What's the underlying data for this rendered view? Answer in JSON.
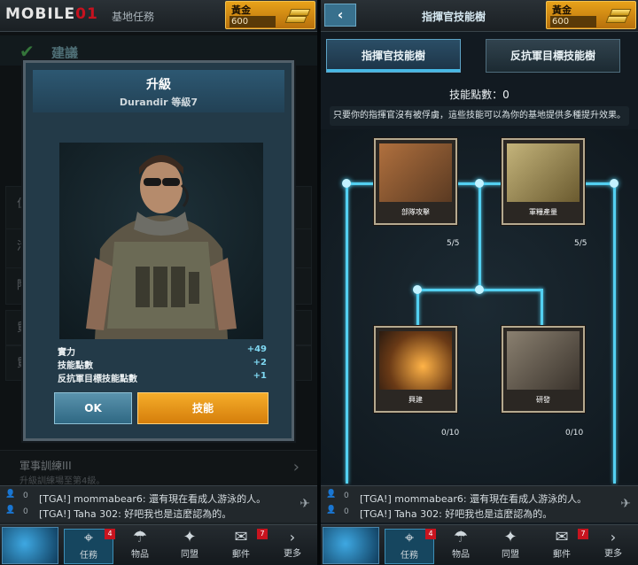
{
  "left": {
    "logo": {
      "part1": "MOBILE",
      "part2": "01"
    },
    "top_subtitle": "基地任務",
    "gold": {
      "label": "黃金",
      "value": "600"
    },
    "suggestion": "建議",
    "bg_rows": [
      "位",
      "活",
      "陶",
      "貿",
      "貿"
    ],
    "military": {
      "title": "軍事訓練III",
      "desc": "升級訓練場至第4級。"
    },
    "modal": {
      "title": "升級",
      "subtitle": "Durandir 等級7",
      "stats": [
        {
          "label": "實力",
          "value": "+49"
        },
        {
          "label": "技能點數",
          "value": "+2"
        },
        {
          "label": "反抗軍目標技能點數",
          "value": "+1"
        }
      ],
      "ok_label": "OK",
      "skill_label": "技能"
    }
  },
  "right": {
    "title": "指揮官技能樹",
    "gold": {
      "label": "黃金",
      "value": "600"
    },
    "tabs": [
      "指揮官技能樹",
      "反抗軍目標技能樹"
    ],
    "points_label": "技能點數：0",
    "description": "只要你的指揮官沒有被俘虜，這些技能可以為你的基地提供多種提升效果。",
    "skills": [
      {
        "name": "部隊攻擊",
        "count": "5/5"
      },
      {
        "name": "軍糧產量",
        "count": "5/5"
      },
      {
        "name": "興建",
        "count": "0/10"
      },
      {
        "name": "研發",
        "count": "0/10"
      }
    ]
  },
  "chat": {
    "counts": [
      "0",
      "0"
    ],
    "messages": [
      "[TGA!] mommabear6: 還有現在看成人游泳的人。",
      "[TGA!] Taha 302: 好吧我也是這麼認為的。"
    ]
  },
  "nav": {
    "items": [
      {
        "label": "任務",
        "badge": "4"
      },
      {
        "label": "物品",
        "badge": ""
      },
      {
        "label": "同盟",
        "badge": ""
      },
      {
        "label": "郵件",
        "badge": "7"
      },
      {
        "label": "更多",
        "badge": ""
      }
    ]
  },
  "colors": {
    "accent": "#53d0f1",
    "gold": "#d57e0b",
    "badge": "#c8141f"
  }
}
